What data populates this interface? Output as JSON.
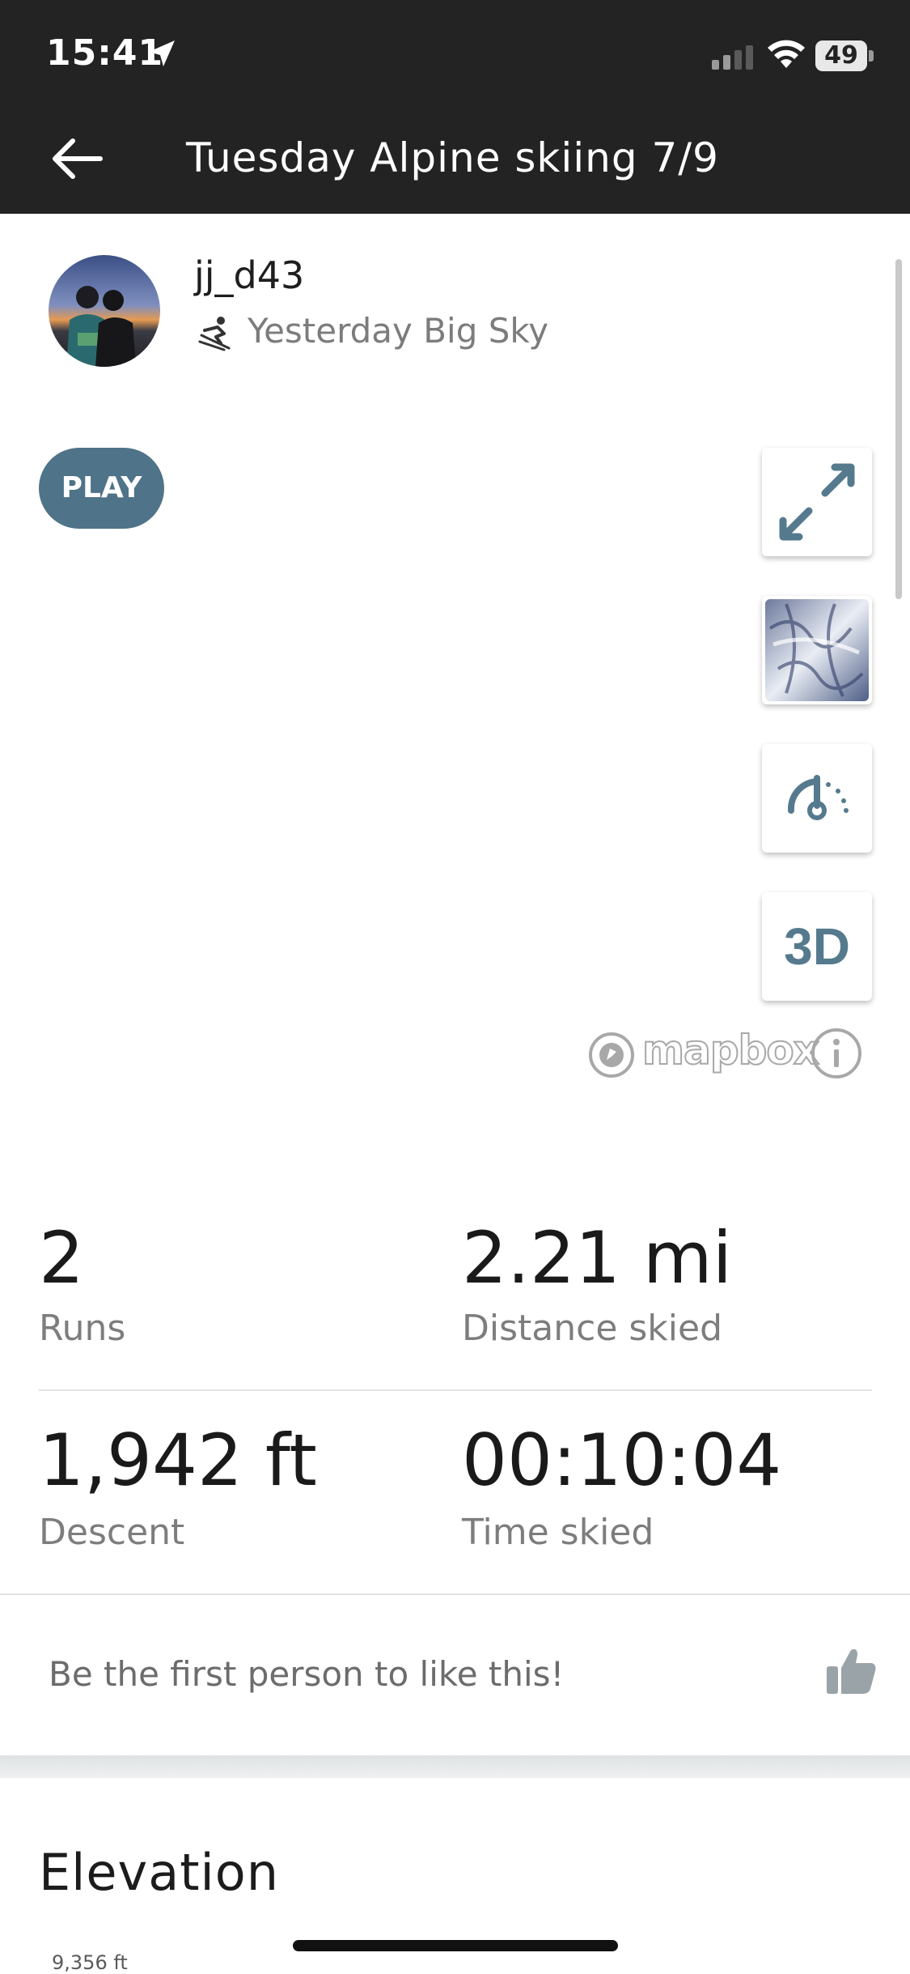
{
  "status": {
    "time": "15:41",
    "battery": "49"
  },
  "header": {
    "title": "Tuesday Alpine skiing 7/9"
  },
  "activity": {
    "username": "jj_d43",
    "subtitle": "Yesterday Big Sky"
  },
  "map": {
    "play_label": "PLAY",
    "controls": [
      "expand-icon",
      "satellite-layer-icon",
      "speed-gauge-icon"
    ],
    "three_d_label": "3D",
    "attribution": "mapbox"
  },
  "stats": {
    "runs": {
      "value": "2",
      "label": "Runs"
    },
    "distance": {
      "value": "2.21 mi",
      "label": "Distance skied"
    },
    "descent": {
      "value": "1,942 ft",
      "label": "Descent"
    },
    "time": {
      "value": "00:10:04",
      "label": "Time skied"
    }
  },
  "likes": {
    "prompt": "Be the first person to like this!"
  },
  "elevation": {
    "title": "Elevation",
    "top_tick": "9,356 ft"
  },
  "colors": {
    "header_bg": "#232323",
    "accent": "#557a8e",
    "play_bg": "#4f7388"
  }
}
